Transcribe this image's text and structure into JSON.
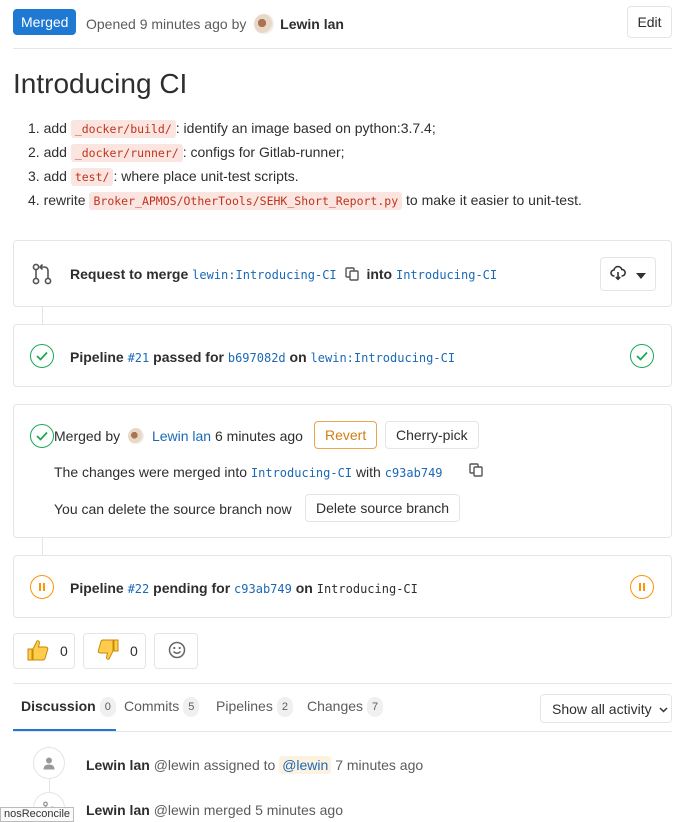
{
  "header": {
    "status": "Merged",
    "opened_prefix": "Opened",
    "time_ago": "9 minutes ago",
    "by": "by",
    "author": "Lewin lan",
    "edit_label": "Edit"
  },
  "title": "Introducing CI",
  "description": {
    "items": [
      {
        "num": "1.",
        "verb": "add",
        "code": "_docker/build/",
        "rest": ": identify an image based on python:3.7.4;"
      },
      {
        "num": "2.",
        "verb": "add",
        "code": "_docker/runner/",
        "rest": ": configs for Gitlab-runner;"
      },
      {
        "num": "3.",
        "verb": "add",
        "code": "test/",
        "rest": ": where place unit-test scripts."
      },
      {
        "num": "4.",
        "verb": "rewrite",
        "code": "Broker_APMOS/OtherTools/SEHK_Short_Report.py",
        "rest": "to make it easier to unit-test."
      }
    ]
  },
  "merge_request": {
    "request_label": "Request to merge",
    "source_ns": "lewin",
    "source_sep": ":",
    "source_branch": "Introducing-CI",
    "into": "into",
    "target_branch": "Introducing-CI"
  },
  "pipeline_21": {
    "label": "Pipeline",
    "id": "#21",
    "status_text": "passed for",
    "commit": "b697082d",
    "on": "on",
    "ref_ns": "lewin",
    "ref_sep": ":",
    "ref_branch": "Introducing-CI"
  },
  "merged": {
    "label": "Merged by",
    "user": "Lewin lan",
    "time": "6 minutes ago",
    "revert": "Revert",
    "cherry_pick": "Cherry-pick",
    "changes_prefix": "The changes were merged into",
    "changes_branch": "Introducing-CI",
    "changes_with": "with",
    "changes_commit": "c93ab749",
    "delete_text": "You can delete the source branch now",
    "delete_button": "Delete source branch"
  },
  "pipeline_22": {
    "label": "Pipeline",
    "id": "#22",
    "status_text": "pending for",
    "commit": "c93ab749",
    "on": "on",
    "ref_branch": "Introducing-CI"
  },
  "awards": {
    "thumbs_up": "0",
    "thumbs_down": "0"
  },
  "tabs": [
    {
      "label": "Discussion",
      "count": "0"
    },
    {
      "label": "Commits",
      "count": "5"
    },
    {
      "label": "Pipelines",
      "count": "2"
    },
    {
      "label": "Changes",
      "count": "7"
    }
  ],
  "activity_filter": "Show all activity",
  "notes": [
    {
      "author": "Lewin lan",
      "handle": "@lewin",
      "action": "assigned to",
      "mention": "@lewin",
      "time": "7 minutes ago"
    },
    {
      "author": "Lewin lan",
      "handle": "@lewin",
      "action": "merged",
      "time": "5 minutes ago"
    }
  ],
  "tooltip_fragment": "nosReconcile",
  "colors": {
    "primary": "#1f78d1",
    "success": "#1aaa55",
    "pending": "#fc9403",
    "link": "#1b69b6",
    "code_bg": "#fbe5e1",
    "code_fg": "#c0341d"
  }
}
